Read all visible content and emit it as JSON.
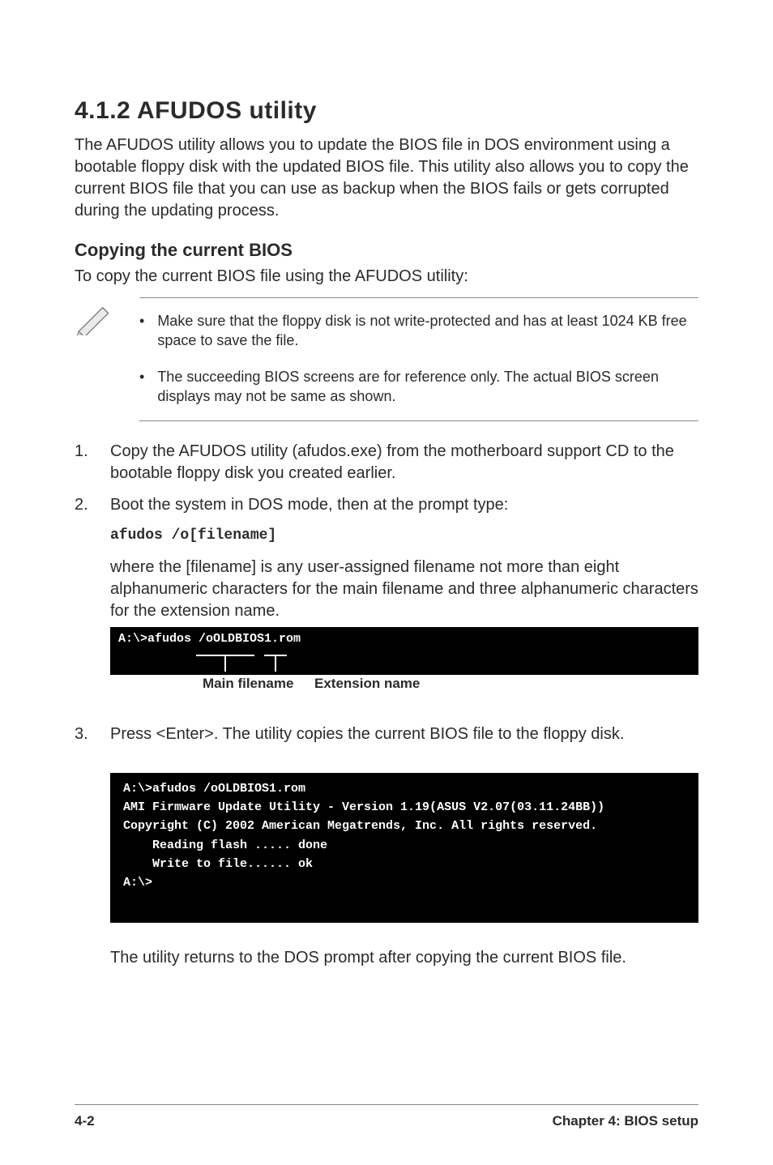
{
  "section_title": "4.1.2   AFUDOS utility",
  "intro_paragraph": "The AFUDOS utility allows you to update the BIOS file in DOS environment using a bootable floppy disk with the updated BIOS file. This utility also allows you to copy the current BIOS file that you can use as backup when the BIOS fails or gets corrupted during the updating process.",
  "subheading": "Copying the current BIOS",
  "sub_intro": "To copy the current BIOS file using the AFUDOS utility:",
  "note_bullets": [
    "Make sure that the floppy disk is not write-protected and has at least 1024 KB free space to save the file.",
    "The succeeding BIOS screens are for reference only. The actual BIOS screen displays may not be same as shown."
  ],
  "steps": [
    {
      "num": "1.",
      "text": "Copy the AFUDOS utility (afudos.exe) from the motherboard support CD to the bootable floppy disk you created earlier."
    },
    {
      "num": "2.",
      "text": "Boot the system in DOS mode, then at the prompt type:",
      "code": "afudos /o[filename]",
      "after_code": "where the [filename] is any user-assigned filename not more than eight alphanumeric characters for the main filename and three alphanumeric characters for the extension name.",
      "terminal": "A:\\>afudos /oOLDBIOS1.rom",
      "label_main": "Main filename",
      "label_ext": "Extension name"
    },
    {
      "num": "3.",
      "text": "Press <Enter>. The utility copies the current BIOS file to the floppy disk.",
      "terminal2": "A:\\>afudos /oOLDBIOS1.rom\nAMI Firmware Update Utility - Version 1.19(ASUS V2.07(03.11.24BB))\nCopyright (C) 2002 American Megatrends, Inc. All rights reserved.\n    Reading flash ..... done\n    Write to file...... ok\nA:\\>\n ",
      "tail": "The utility returns to the DOS prompt after copying the current BIOS file."
    }
  ],
  "footer_left": "4-2",
  "footer_right": "Chapter 4: BIOS setup"
}
